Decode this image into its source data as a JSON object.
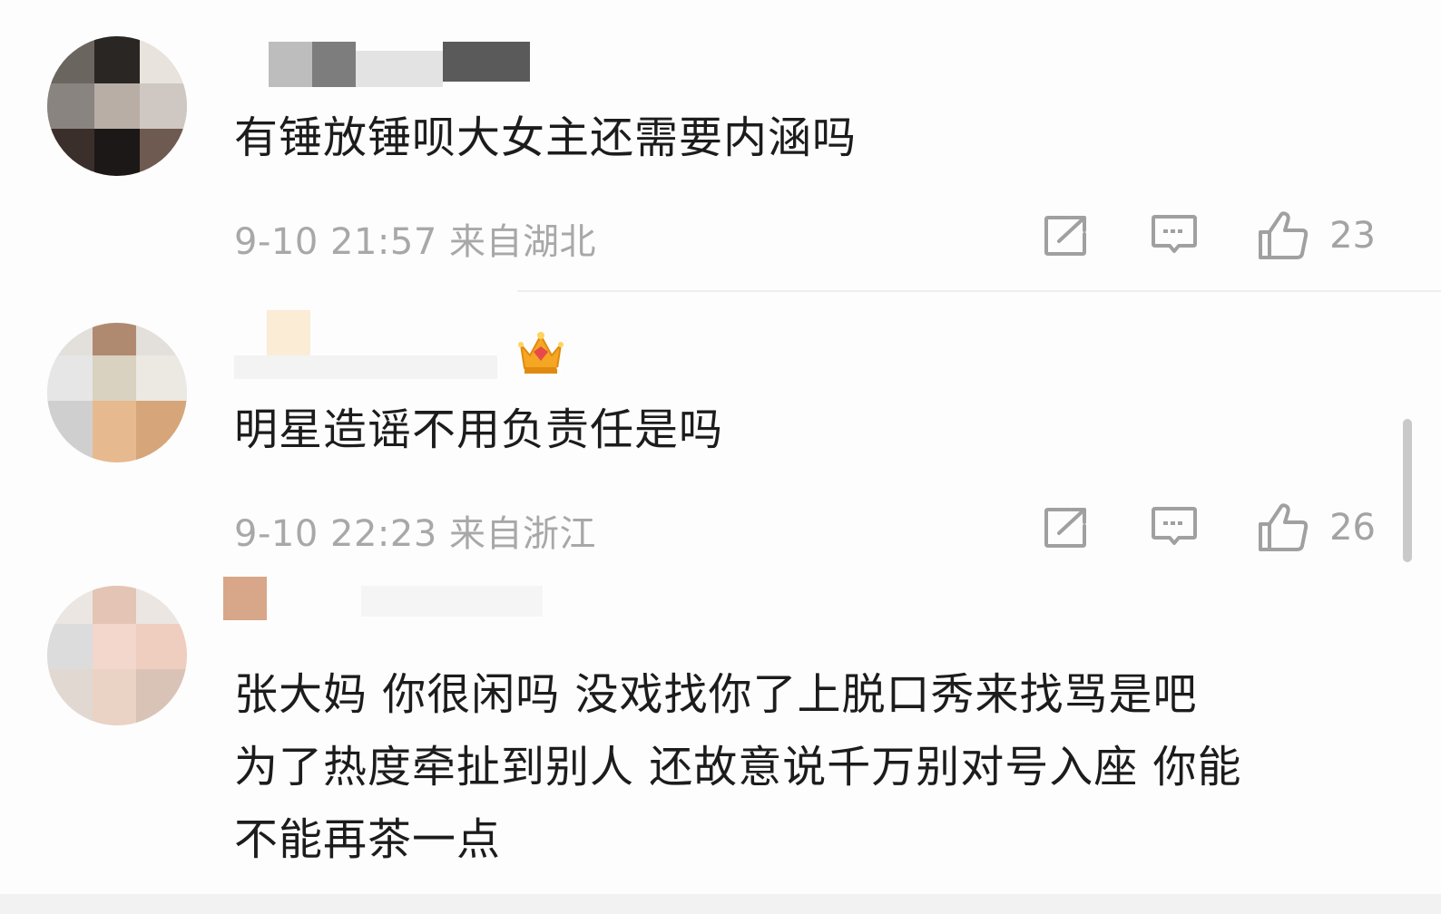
{
  "comments": [
    {
      "text": "有锤放锤呗大女主还需要内涵吗",
      "date": "9-10 21:57",
      "location": "来自湖北",
      "likes": "23",
      "share_icon": "share-icon",
      "reply_icon": "comment-icon",
      "like_icon": "thumbs-up-icon"
    },
    {
      "text": "明星造谣不用负责任是吗",
      "date": "9-10 22:23",
      "location": "来自浙江",
      "likes": "26",
      "badge_icon": "crown-badge-icon",
      "share_icon": "share-icon",
      "reply_icon": "comment-icon",
      "like_icon": "thumbs-up-icon"
    },
    {
      "text": "张大妈 你很闲吗 没戏找你了上脱口秀来找骂是吧\n为了热度牵扯到别人 还故意说千万别对号入座 你能\n不能再茶一点"
    }
  ],
  "colors": {
    "text": "#1c1c1c",
    "meta": "#a8a8a8",
    "icon": "#9a9a9a",
    "crown": "#f5a623"
  }
}
